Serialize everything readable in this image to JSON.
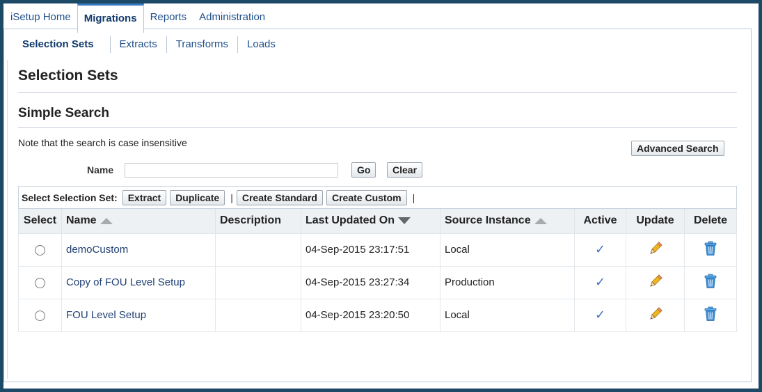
{
  "tabs": [
    "iSetup Home",
    "Migrations",
    "Reports",
    "Administration"
  ],
  "active_tab": "Migrations",
  "subtabs": [
    "Selection Sets",
    "Extracts",
    "Transforms",
    "Loads"
  ],
  "page_title": "Selection Sets",
  "section_title": "Simple Search",
  "note": "Note that the search is case insensitive",
  "advanced_search": "Advanced Search",
  "search": {
    "label": "Name",
    "value": "",
    "go": "Go",
    "clear": "Clear"
  },
  "toolbar": {
    "label": "Select Selection Set:",
    "extract": "Extract",
    "duplicate": "Duplicate",
    "separator": "|",
    "create_standard": "Create Standard",
    "create_custom": "Create Custom"
  },
  "table": {
    "headers": {
      "select": "Select",
      "name": "Name",
      "description": "Description",
      "last_updated": "Last Updated On",
      "source_instance": "Source Instance",
      "active": "Active",
      "update": "Update",
      "delete": "Delete"
    },
    "rows": [
      {
        "name": "demoCustom",
        "description": "",
        "last_updated": "04-Sep-2015 23:17:51",
        "source_instance": "Local",
        "active": "✓"
      },
      {
        "name": "Copy of FOU Level Setup",
        "description": "",
        "last_updated": "04-Sep-2015 23:27:34",
        "source_instance": "Production",
        "active": "✓"
      },
      {
        "name": "FOU Level Setup",
        "description": "",
        "last_updated": "04-Sep-2015 23:20:50",
        "source_instance": "Local",
        "active": "✓"
      }
    ]
  },
  "colors": {
    "frame": "#1c4966",
    "link": "#1f4f8a",
    "active_tab_border": "#3a7bbf",
    "check": "#3f73c2",
    "pencil": "#f0b41e",
    "trash": "#3f8fd4"
  },
  "icons": {
    "active": "checkmark-icon",
    "update": "pencil-icon",
    "delete": "trash-icon",
    "sort_asc": "sort-ascending-icon",
    "sort_desc": "sort-descending-icon"
  }
}
